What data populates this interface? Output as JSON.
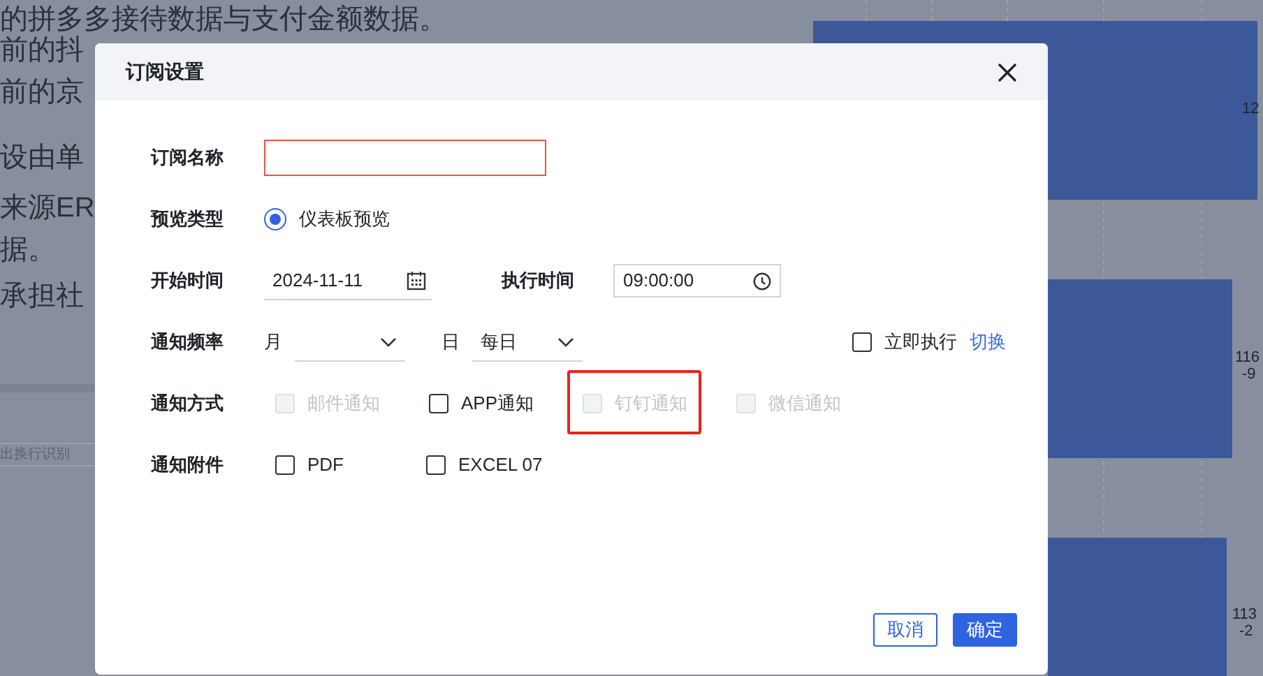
{
  "background": {
    "lines": [
      "的拼多多接待数据与支付金额数据。",
      "前的抖",
      "前的京",
      "设由单",
      "来源ER",
      "据。",
      "承担社"
    ],
    "hint": "出换行识别",
    "bar_labels": [
      [
        "12"
      ],
      [
        "116",
        "-9"
      ],
      [
        "113",
        "-2"
      ]
    ]
  },
  "dialog": {
    "title": "订阅设置",
    "name": {
      "label": "订阅名称",
      "error": true
    },
    "preview": {
      "label": "预览类型",
      "options": [
        {
          "label": "仪表板预览",
          "selected": true
        }
      ]
    },
    "start": {
      "label": "开始时间",
      "value": "2024-11-11"
    },
    "exec": {
      "label": "执行时间",
      "value": "09:00:00"
    },
    "frequency": {
      "label": "通知频率",
      "month_label": "月",
      "day_label": "日",
      "day_value": "每日",
      "run_now": {
        "label": "立即执行",
        "checked": false
      },
      "switch_link": "切换"
    },
    "methods": {
      "label": "通知方式",
      "options": [
        {
          "label": "邮件通知",
          "checked": false,
          "disabled": true,
          "highlighted": false
        },
        {
          "label": "APP通知",
          "checked": false,
          "disabled": false,
          "highlighted": false
        },
        {
          "label": "钉钉通知",
          "checked": false,
          "disabled": true,
          "highlighted": true
        },
        {
          "label": "微信通知",
          "checked": false,
          "disabled": true,
          "highlighted": false
        }
      ]
    },
    "attachments": {
      "label": "通知附件",
      "options": [
        {
          "label": "PDF",
          "checked": false,
          "disabled": false
        },
        {
          "label": "EXCEL 07",
          "checked": false,
          "disabled": false
        }
      ]
    },
    "buttons": [
      {
        "label": "取消",
        "kind": "secondary"
      },
      {
        "label": "确定",
        "kind": "primary"
      }
    ]
  }
}
